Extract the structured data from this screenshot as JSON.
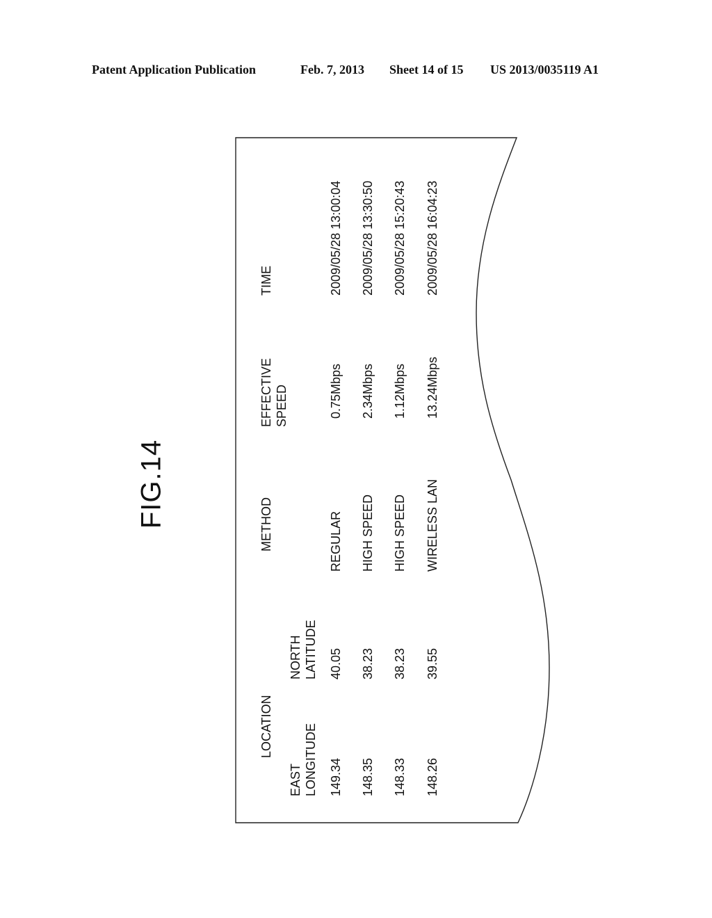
{
  "header": {
    "publication": "Patent Application Publication",
    "date": "Feb. 7, 2013",
    "sheet": "Sheet 14 of 15",
    "number": "US 2013/0035119 A1"
  },
  "figure": {
    "title": "FIG.14"
  },
  "table": {
    "columns": {
      "location": "LOCATION",
      "east_longitude_line1": "EAST",
      "east_longitude_line2": "LONGITUDE",
      "north_latitude_line1": "NORTH",
      "north_latitude_line2": "LATITUDE",
      "method": "METHOD",
      "effective_speed_line1": "EFFECTIVE",
      "effective_speed_line2": "SPEED",
      "time": "TIME"
    },
    "rows": [
      {
        "east_longitude": "149.34",
        "north_latitude": "40.05",
        "method": "REGULAR",
        "effective_speed": "0.75Mbps",
        "time": "2009/05/28 13:00:04"
      },
      {
        "east_longitude": "148.35",
        "north_latitude": "38.23",
        "method": "HIGH SPEED",
        "effective_speed": "2.34Mbps",
        "time": "2009/05/28 13:30:50"
      },
      {
        "east_longitude": "148.33",
        "north_latitude": "38.23",
        "method": "HIGH SPEED",
        "effective_speed": "1.12Mbps",
        "time": "2009/05/28 15:20:43"
      },
      {
        "east_longitude": "148.26",
        "north_latitude": "39.55",
        "method": "WIRELESS LAN",
        "effective_speed": "13.24Mbps",
        "time": "2009/05/28 16:04:23"
      }
    ]
  }
}
